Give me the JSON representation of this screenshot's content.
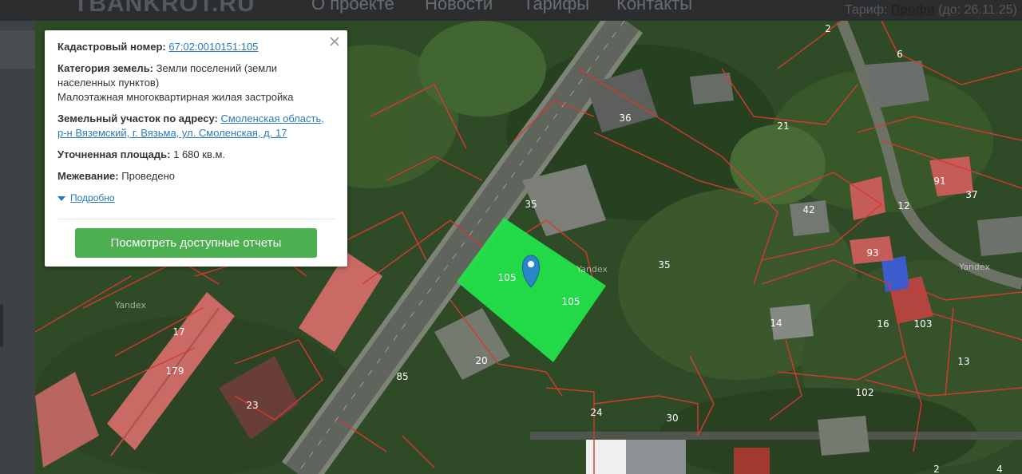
{
  "header": {
    "brand": "TBANKROT.RU",
    "nav": [
      "О проекте",
      "Новости",
      "Тарифы",
      "Контакты"
    ],
    "tariff_prefix": "Тариф:",
    "tariff_name": "Профи",
    "tariff_until": "(до: 26.11.25)"
  },
  "popup": {
    "cadastral_label": "Кадастровый номер:",
    "cadastral_value": "67:02:0010151:105",
    "category_label": "Категория земель:",
    "category_value": "Земли поселений (земли населенных пунктов)",
    "use_value": "Малоэтажная многоквартирная жилая застройка",
    "address_label": "Земельный участок по адресу:",
    "address_value": "Смоленская область, р-н Вяземский, г. Вязьма, ул. Смоленская, д. 17",
    "area_label": "Уточненная площадь:",
    "area_value": "1 680 кв.м.",
    "survey_label": "Межевание:",
    "survey_value": "Проведено",
    "more_link": "Подробно",
    "reports_button": "Посмотреть доступные отчеты",
    "close_icon": "close-icon"
  },
  "map": {
    "watermarks": [
      "Yandex",
      "Yandex",
      "Yandex"
    ],
    "parcel_labels": [
      "36",
      "21",
      "2",
      "6",
      "35",
      "42",
      "12",
      "37",
      "17",
      "179",
      "23",
      "85",
      "20",
      "105",
      "105",
      "35",
      "14",
      "16",
      "103",
      "13",
      "102",
      "24",
      "30",
      "2",
      "4",
      "91",
      "93"
    ],
    "colors": {
      "selected_parcel": "#22e04a",
      "parcel_border": "#d43a2f",
      "marker": "#2a86c9",
      "button": "#4caf50"
    }
  }
}
